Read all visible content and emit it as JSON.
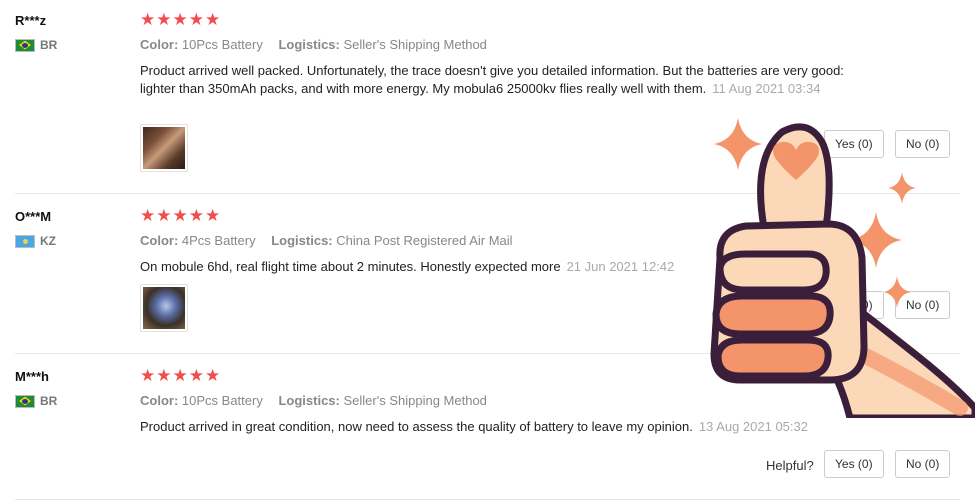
{
  "labels": {
    "color": "Color:",
    "logistics": "Logistics:",
    "helpful": "Helpful?"
  },
  "reviews": [
    {
      "user": "R***z",
      "country": "BR",
      "stars": "★★★★★",
      "color": "10Pcs Battery",
      "logistics": "Seller's Shipping Method",
      "text": "Product arrived well packed. Unfortunately, the trace doesn't give you detailed information. But the batteries are very good: lighter than 350mAh packs, and with more energy. My mobula6 25000kv flies really well with them.",
      "date": "11 Aug 2021 03:34",
      "yes": "Yes (0)",
      "no": "No (0)"
    },
    {
      "user": "O***M",
      "country": "KZ",
      "stars": "★★★★★",
      "color": "4Pcs Battery",
      "logistics": "China Post Registered Air Mail",
      "text": "On mobule 6hd, real flight time about 2 minutes. Honestly expected more",
      "date": "21 Jun 2021 12:42",
      "yes": "Yes (0)",
      "no": "No (0)"
    },
    {
      "user": "M***h",
      "country": "BR",
      "stars": "★★★★★",
      "color": "10Pcs Battery",
      "logistics": "Seller's Shipping Method",
      "text": "Product arrived in great condition, now need to assess the quality of battery to leave my opinion.",
      "date": "13 Aug 2021 05:32",
      "yes": "Yes (0)",
      "no": "No (0)"
    }
  ],
  "colors": {
    "star": "#f24d4d",
    "muted": "#888888",
    "sticker_skin": "#fbd9b8",
    "sticker_accent": "#f4946b"
  }
}
